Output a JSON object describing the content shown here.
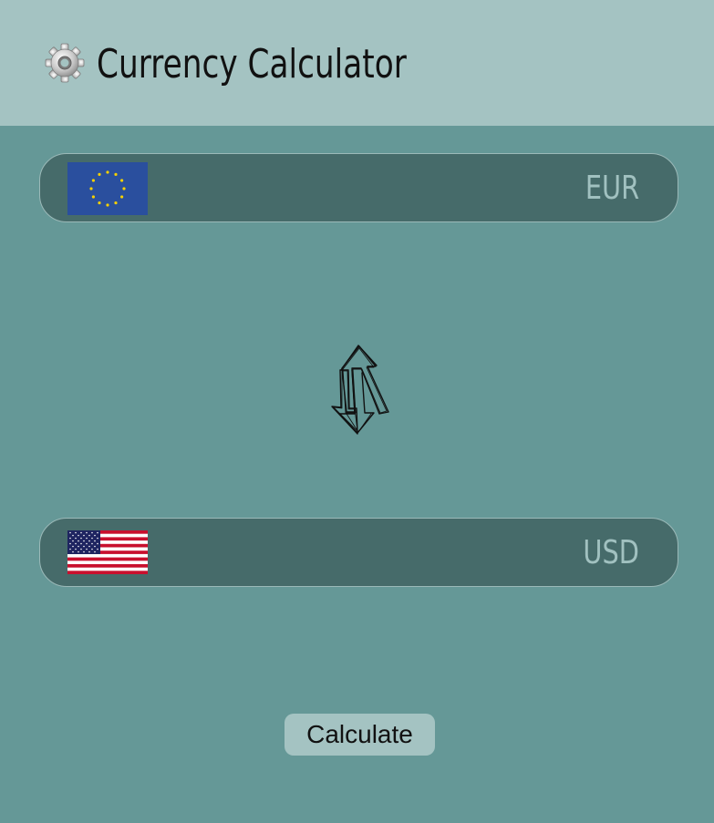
{
  "header": {
    "title": "Currency Calculator",
    "icon": "gear-icon"
  },
  "from_currency": {
    "code": "EUR",
    "flag": "eu-flag-icon"
  },
  "to_currency": {
    "code": "USD",
    "flag": "us-flag-icon"
  },
  "swap": {
    "icon": "swap-arrows-icon"
  },
  "actions": {
    "calculate_label": "Calculate"
  },
  "colors": {
    "background": "#659897",
    "header_background": "#a4c3c2",
    "row_background": "#466b6a",
    "code_text": "#a1c1c0"
  }
}
